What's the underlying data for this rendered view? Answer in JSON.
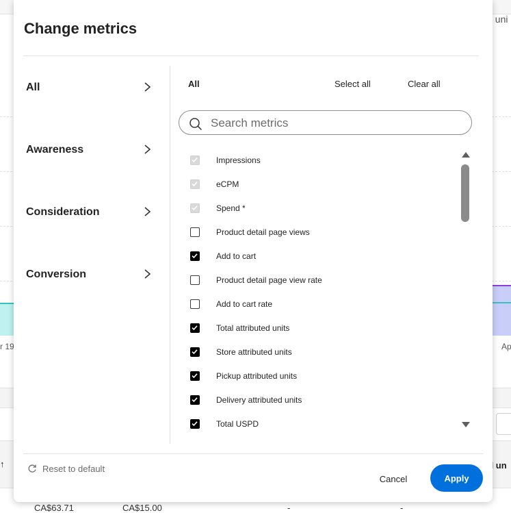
{
  "background": {
    "right_text": ". uni",
    "tick_left": "r 19",
    "tick_right": "Ap",
    "table_header_partial": "ed un",
    "sort_glyph": "↑",
    "cells": [
      "CA$63.71",
      "CA$15.00",
      "-",
      "-"
    ]
  },
  "modal": {
    "title": "Change metrics",
    "categories": [
      {
        "label": "All",
        "icon": "chevron-right-icon"
      },
      {
        "label": "Awareness",
        "icon": "chevron-right-icon"
      },
      {
        "label": "Consideration",
        "icon": "chevron-right-icon"
      },
      {
        "label": "Conversion",
        "icon": "chevron-right-icon"
      }
    ],
    "panel": {
      "label": "All",
      "select_all": "Select all",
      "clear_all": "Clear all",
      "search_placeholder": "Search metrics",
      "search_value": ""
    },
    "metrics": [
      {
        "label": "Impressions",
        "checked": true,
        "disabled": true
      },
      {
        "label": "eCPM",
        "checked": true,
        "disabled": true
      },
      {
        "label": "Spend *",
        "checked": true,
        "disabled": true
      },
      {
        "label": "Product detail page views",
        "checked": false,
        "disabled": false
      },
      {
        "label": "Add to cart",
        "checked": true,
        "disabled": false
      },
      {
        "label": "Product detail page view rate",
        "checked": false,
        "disabled": false
      },
      {
        "label": "Add to cart rate",
        "checked": false,
        "disabled": false
      },
      {
        "label": "Total attributed units",
        "checked": true,
        "disabled": false
      },
      {
        "label": "Store attributed units",
        "checked": true,
        "disabled": false
      },
      {
        "label": "Pickup attributed units",
        "checked": true,
        "disabled": false
      },
      {
        "label": "Delivery attributed units",
        "checked": true,
        "disabled": false
      },
      {
        "label": "Total USPD",
        "checked": true,
        "disabled": false
      }
    ],
    "footer": {
      "reset_label": "Reset to default",
      "cancel_label": "Cancel",
      "apply_label": "Apply"
    }
  },
  "colors": {
    "accent": "#0071dc",
    "checkbox_checked": "#000000",
    "checkbox_disabled": "#d9d9d9",
    "chart_teal": "#37c4c0",
    "chart_purple": "#8a3ee0"
  }
}
